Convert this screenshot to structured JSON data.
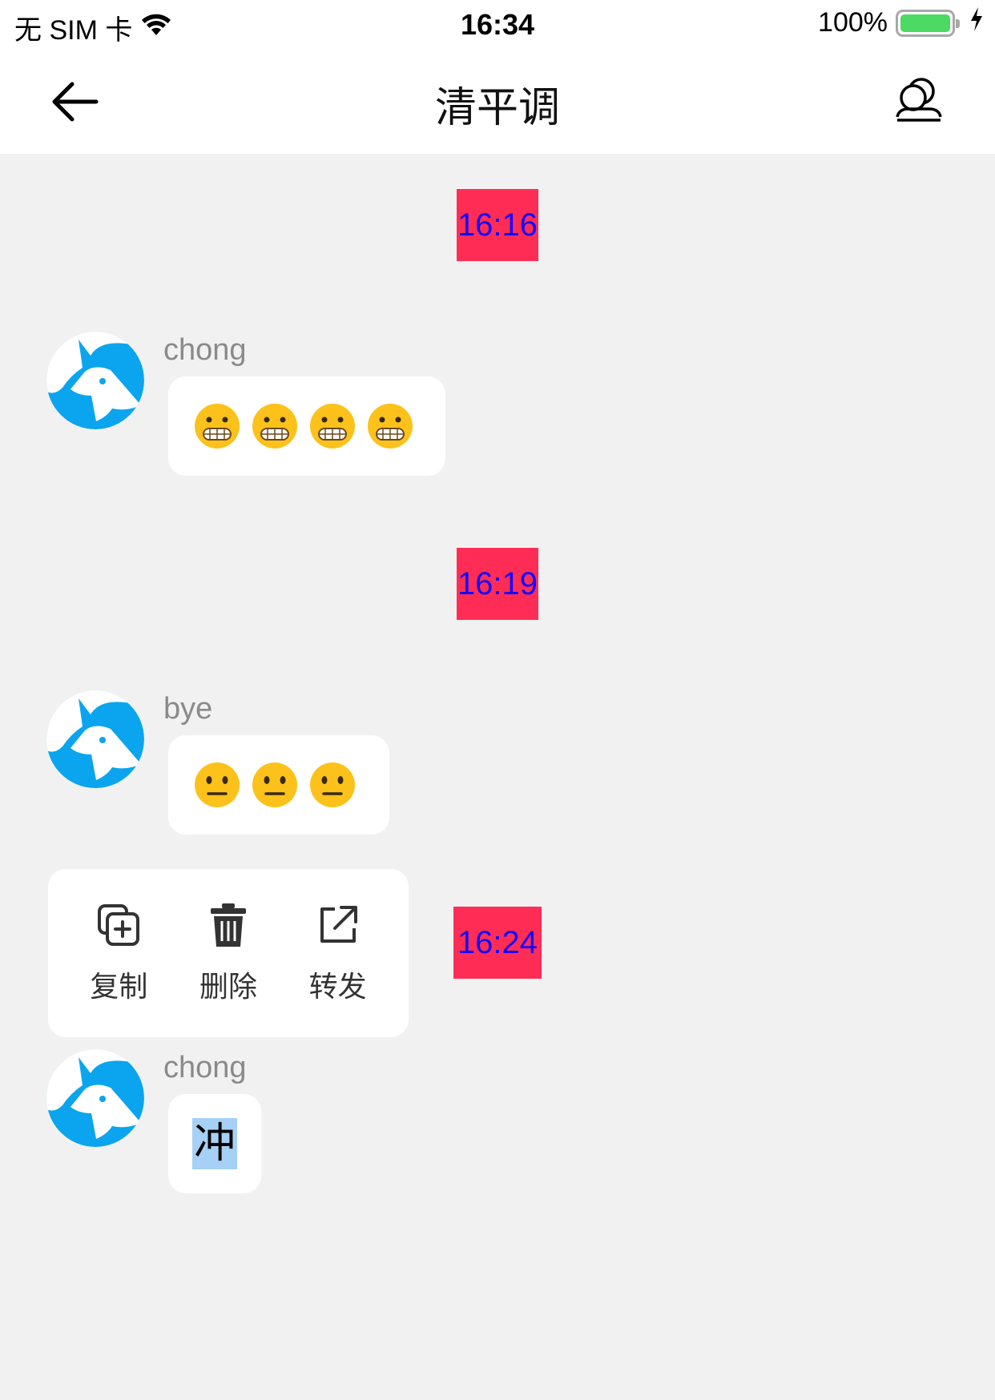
{
  "status_bar": {
    "carrier": "无 SIM 卡",
    "time": "16:34",
    "battery": "100%",
    "battery_level": 1.0
  },
  "nav": {
    "title": "清平调",
    "back_icon": "arrow-left-icon",
    "right_icon": "group-members-icon"
  },
  "messages": [
    {
      "time": "16:16",
      "sender": "chong",
      "emoji_count": 4,
      "emoji": "grimacing-face"
    },
    {
      "time": "16:19",
      "sender": "bye",
      "emoji_count": 3,
      "emoji": "neutral-face"
    },
    {
      "time": "16:24",
      "sender": "chong",
      "text": "冲"
    }
  ],
  "context_menu": {
    "copy": "复制",
    "delete": "删除",
    "forward": "转发"
  },
  "colors": {
    "time_tag_bg": "#ff2d55",
    "time_tag_text": "#1400ff",
    "avatar_blue": "#0aa5ee",
    "selection": "#a6d0f5",
    "battery_green": "#4cd964"
  }
}
